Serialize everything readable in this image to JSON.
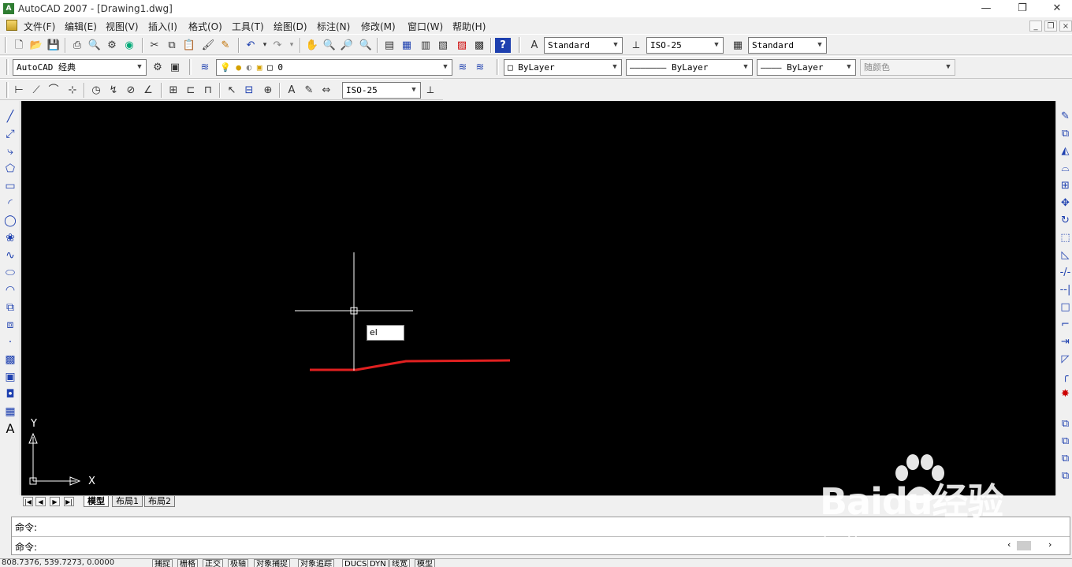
{
  "window": {
    "title": "AutoCAD 2007 - [Drawing1.dwg]",
    "controls": [
      "—",
      "❐",
      "✕"
    ]
  },
  "menu": {
    "items": [
      "文件(F)",
      "编辑(E)",
      "视图(V)",
      "插入(I)",
      "格式(O)",
      "工具(T)",
      "绘图(D)",
      "标注(N)",
      "修改(M)",
      "窗口(W)",
      "帮助(H)"
    ],
    "mdi_controls": [
      "_",
      "❐",
      "×"
    ]
  },
  "toolbar1": {
    "text_style": "Standard",
    "dim_style": "ISO-25",
    "table_style": "Standard"
  },
  "toolbar2": {
    "workspace": "AutoCAD 经典",
    "layer": "0",
    "color": "ByLayer",
    "linetype": "ByLayer",
    "lineweight": "ByLayer",
    "plotstyle": "随颜色"
  },
  "toolbar3": {
    "dim_style": "ISO-25"
  },
  "canvas": {
    "background": "#000000",
    "polyline_color": "#e02020",
    "crosshair_color": "#ffffff",
    "dynamic_input": "el",
    "ucs_x": "X",
    "ucs_y": "Y"
  },
  "layout_tabs": [
    "模型",
    "布局1",
    "布局2"
  ],
  "command": {
    "line1": "命令:",
    "line2": "命令:"
  },
  "status": {
    "coords": "808.7376, 539.7273, 0.0000",
    "buttons": [
      "捕捉",
      "栅格",
      "正交",
      "极轴",
      "对象捕捉",
      "对象追踪",
      "DUCS",
      "DYN",
      "线宽",
      "模型"
    ]
  },
  "watermark": {
    "logo": "Baidu经验",
    "url": "jingyan.baidu.com"
  }
}
